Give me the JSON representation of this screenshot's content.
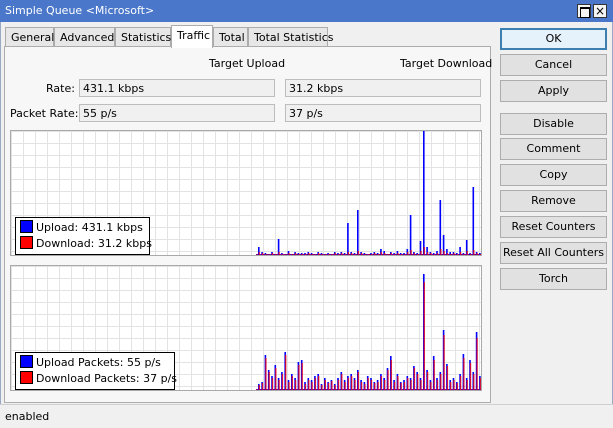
{
  "window": {
    "title": "Simple Queue <Microsoft>",
    "close_glyph": "×"
  },
  "tabs": [
    {
      "label": "General"
    },
    {
      "label": "Advanced"
    },
    {
      "label": "Statistics"
    },
    {
      "label": "Traffic",
      "active": true
    },
    {
      "label": "Total"
    },
    {
      "label": "Total Statistics"
    }
  ],
  "traffic": {
    "col_upload": "Target Upload",
    "col_download": "Target Download",
    "rate_label": "Rate:",
    "rate_upload": "431.1 kbps",
    "rate_download": "31.2 kbps",
    "packet_rate_label": "Packet Rate:",
    "packet_upload": "55 p/s",
    "packet_download": "37 p/s"
  },
  "graphs": {
    "bytes": {
      "legend_upload": "Upload:  431.1 kbps",
      "legend_download": "Download:  31.2 kbps",
      "upload_color": "#0000ff",
      "download_color": "#ff0000",
      "upload_series": [
        8,
        3,
        2,
        0,
        3,
        1,
        16,
        2,
        0,
        4,
        1,
        3,
        2,
        2,
        2,
        3,
        2,
        0,
        3,
        2,
        1,
        2,
        1,
        3,
        2,
        3,
        2,
        32,
        3,
        2,
        45,
        3,
        2,
        1,
        2,
        3,
        2,
        6,
        4,
        1,
        3,
        2,
        4,
        2,
        2,
        6,
        40,
        3,
        2,
        14,
        126,
        8,
        3,
        2,
        4,
        55,
        20,
        6,
        3,
        3,
        2,
        8,
        2,
        15,
        2,
        68,
        3,
        2,
        37
      ],
      "download_series": [
        3,
        2,
        1,
        0,
        2,
        1,
        3,
        1,
        0,
        2,
        1,
        2,
        1,
        1,
        1,
        2,
        1,
        0,
        2,
        1,
        1,
        1,
        1,
        2,
        1,
        2,
        1,
        3,
        2,
        1,
        4,
        2,
        1,
        1,
        1,
        2,
        1,
        3,
        2,
        1,
        2,
        1,
        2,
        1,
        1,
        3,
        5,
        2,
        1,
        4,
        8,
        3,
        2,
        1,
        2,
        6,
        4,
        2,
        1,
        2,
        1,
        3,
        1,
        4,
        1,
        5,
        2,
        1,
        4
      ]
    },
    "packets": {
      "legend_upload": "Upload Packets:  55 p/s",
      "legend_download": "Download Packets:  37 p/s",
      "upload_color": "#0000ff",
      "download_color": "#ff0000",
      "upload_series": [
        6,
        8,
        35,
        20,
        14,
        25,
        12,
        18,
        38,
        10,
        16,
        12,
        28,
        30,
        8,
        12,
        10,
        14,
        16,
        6,
        12,
        8,
        10,
        6,
        12,
        18,
        10,
        14,
        16,
        12,
        20,
        10,
        8,
        14,
        12,
        8,
        10,
        16,
        12,
        22,
        34,
        10,
        16,
        8,
        10,
        14,
        12,
        24,
        18,
        12,
        116,
        20,
        10,
        34,
        12,
        18,
        60,
        26,
        10,
        12,
        8,
        16,
        36,
        12,
        30,
        18,
        58,
        14,
        42
      ],
      "download_series": [
        5,
        7,
        32,
        18,
        12,
        22,
        10,
        16,
        35,
        8,
        14,
        10,
        25,
        27,
        6,
        10,
        8,
        12,
        14,
        5,
        10,
        7,
        9,
        5,
        10,
        16,
        8,
        12,
        14,
        10,
        18,
        8,
        6,
        12,
        10,
        7,
        8,
        14,
        10,
        20,
        30,
        8,
        14,
        7,
        8,
        12,
        10,
        22,
        16,
        10,
        108,
        18,
        8,
        30,
        10,
        16,
        55,
        24,
        8,
        10,
        7,
        14,
        32,
        10,
        27,
        16,
        52,
        12,
        38
      ]
    }
  },
  "buttons": [
    {
      "label": "OK",
      "primary": true
    },
    {
      "label": "Cancel"
    },
    {
      "label": "Apply"
    },
    {
      "label": "Disable"
    },
    {
      "label": "Comment"
    },
    {
      "label": "Copy"
    },
    {
      "label": "Remove"
    },
    {
      "label": "Reset Counters"
    },
    {
      "label": "Reset All Counters"
    },
    {
      "label": "Torch"
    }
  ],
  "status": {
    "text": "enabled"
  }
}
